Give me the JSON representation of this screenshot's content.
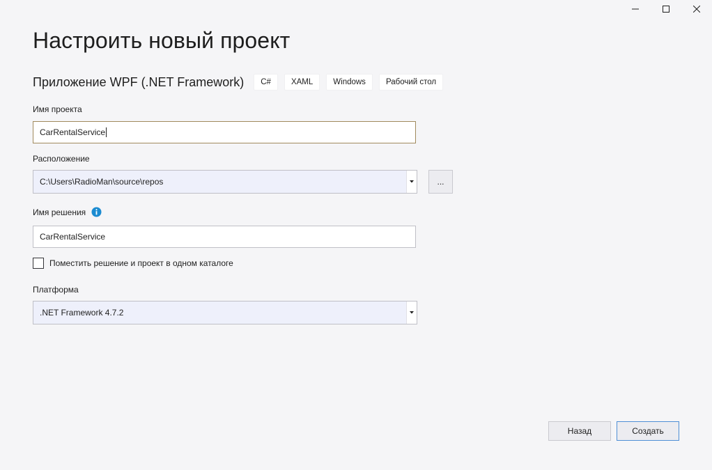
{
  "window": {
    "controls": [
      "minimize-icon",
      "maximize-icon",
      "close-icon"
    ]
  },
  "page_title": "Настроить новый проект",
  "template": {
    "name": "Приложение WPF (.NET Framework)",
    "tags": [
      "C#",
      "XAML",
      "Windows",
      "Рабочий стол"
    ]
  },
  "project_name": {
    "label": "Имя проекта",
    "value": "CarRentalService"
  },
  "location": {
    "label": "Расположение",
    "value": "C:\\Users\\RadioMan\\source\\repos",
    "browse_label": "..."
  },
  "solution_name": {
    "label": "Имя решения",
    "value": "CarRentalService",
    "info_icon": "info-icon"
  },
  "same_directory": {
    "label": "Поместить решение и проект в одном каталоге",
    "checked": false
  },
  "framework": {
    "label": "Платформа",
    "value": ".NET Framework 4.7.2"
  },
  "buttons": {
    "back": "Назад",
    "create": "Создать"
  },
  "colors": {
    "background": "#f5f5f7",
    "accent_border": "#4f8fd6",
    "info_icon": "#1b8bd1",
    "focused_input_border": "#a0895c"
  }
}
